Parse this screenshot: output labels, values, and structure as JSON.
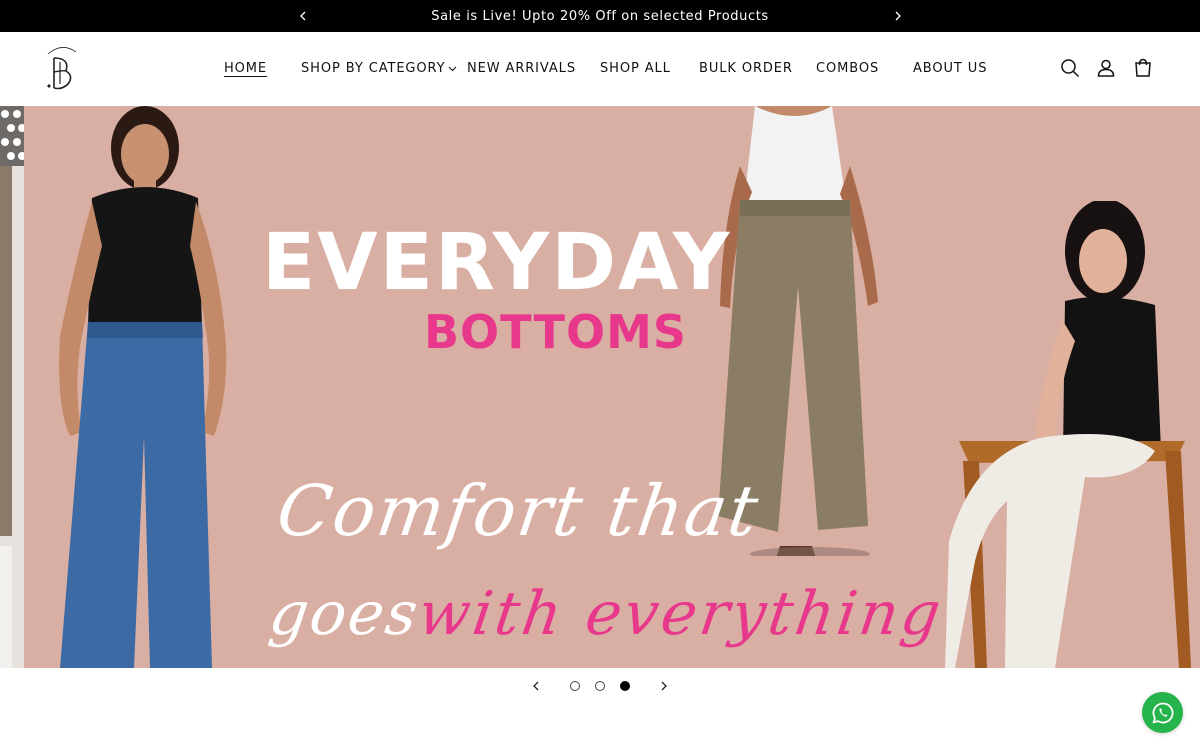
{
  "announcement": {
    "message": "Sale is Live! Upto 20% Off on selected Products",
    "prev_icon": "chevron-left-icon",
    "next_icon": "chevron-right-icon"
  },
  "header": {
    "logo": "brand-logo",
    "nav": [
      {
        "label": "HOME",
        "active": true
      },
      {
        "label": "SHOP BY CATEGORY",
        "dropdown": true
      },
      {
        "label": "NEW ARRIVALS"
      },
      {
        "label": "SHOP ALL"
      },
      {
        "label": "BULK ORDER"
      },
      {
        "label": "COMBOS"
      },
      {
        "label": "ABOUT US"
      }
    ],
    "icons": [
      "search-icon",
      "account-icon",
      "cart-icon"
    ]
  },
  "hero": {
    "headline": "EVERYDAY",
    "subheadline": "BOTTOMS",
    "tagline_line1": "Comfort that",
    "tagline_line2_a": "goes",
    "tagline_line2_b": "with everything",
    "background_color": "#d9aea3",
    "accent_color": "#e8388c"
  },
  "slider": {
    "slide_count": 3,
    "active_slide": 3
  },
  "whatsapp": {
    "icon": "whatsapp-icon",
    "color": "#25b34b"
  }
}
